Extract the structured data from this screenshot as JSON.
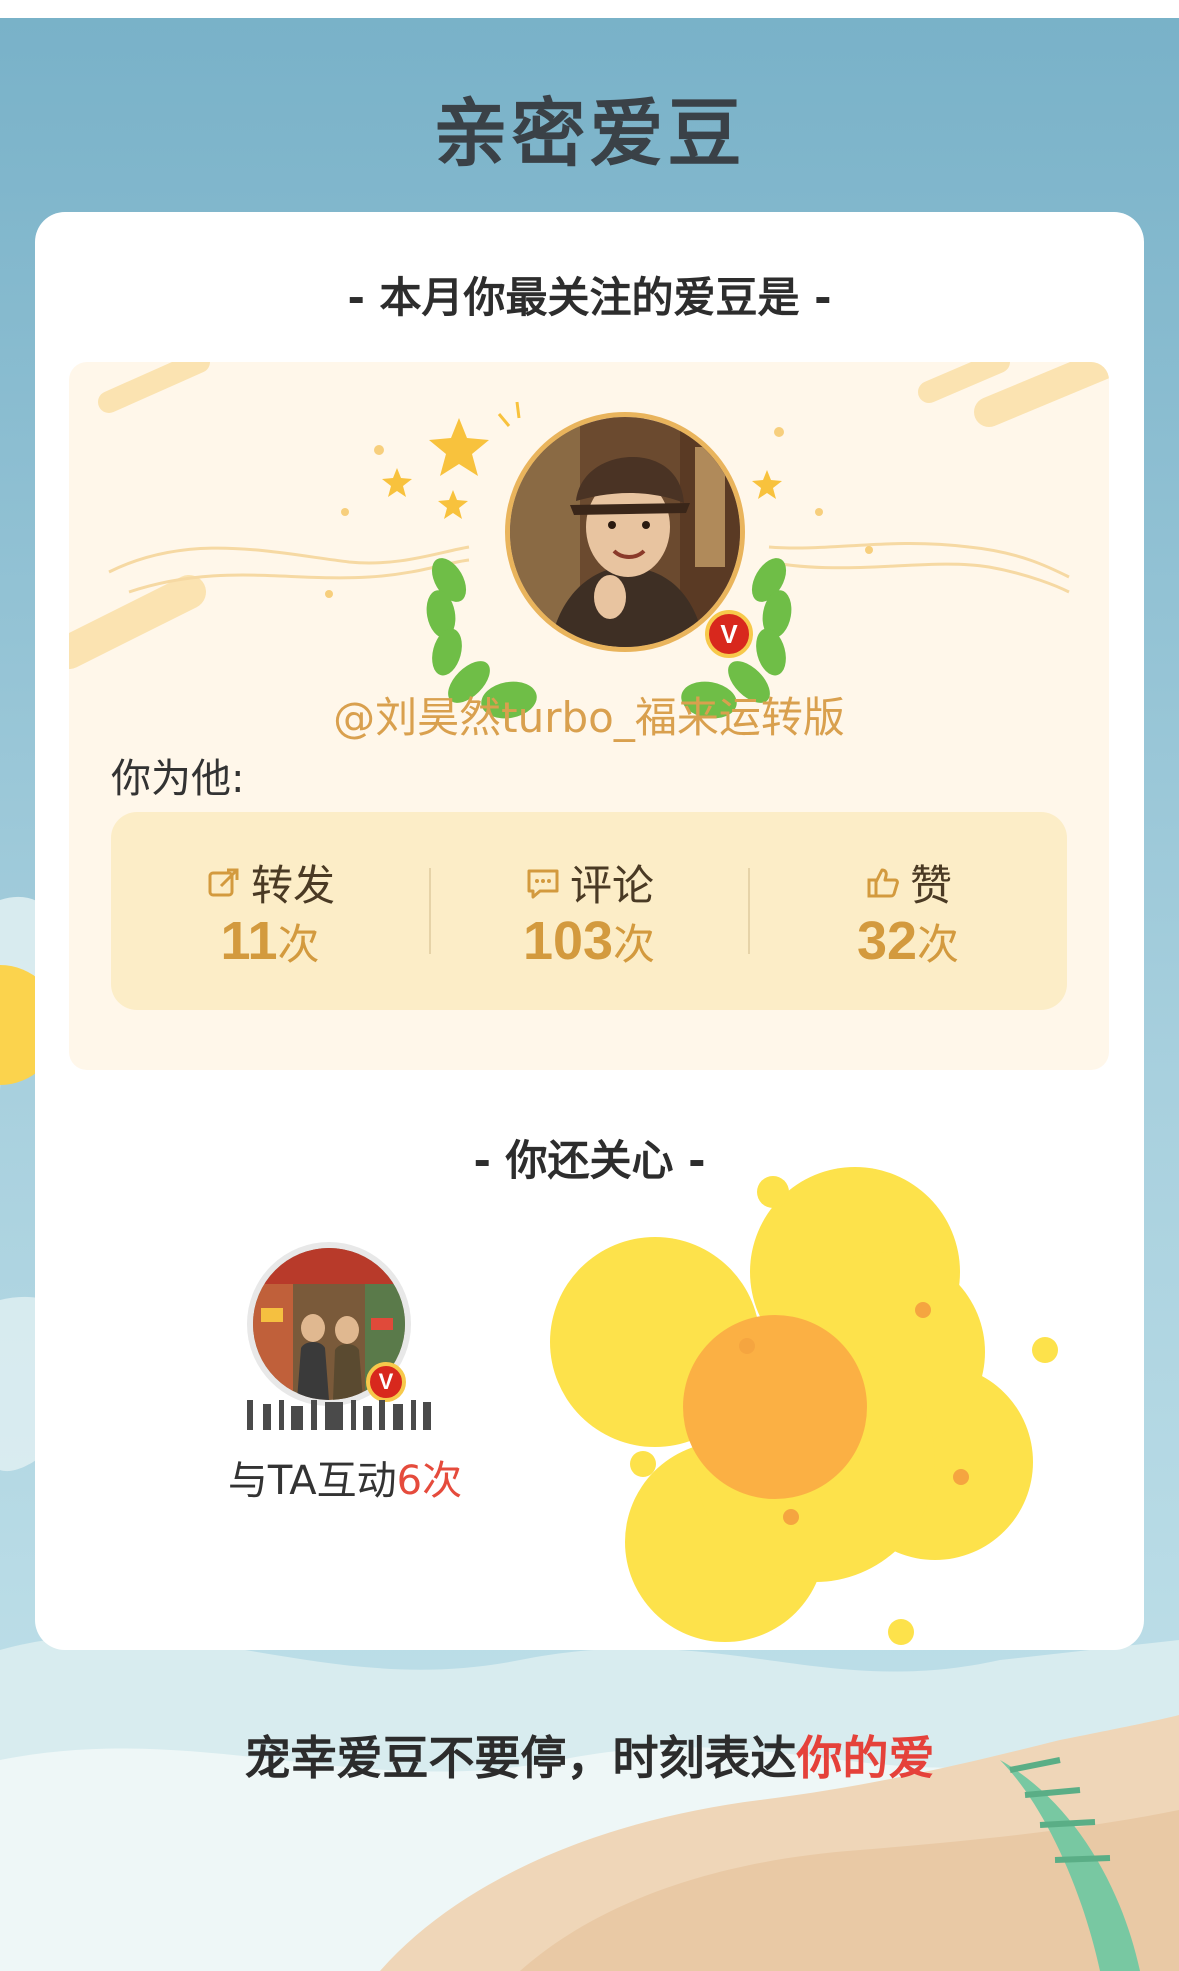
{
  "page": {
    "title": "亲密爱豆"
  },
  "top_idol": {
    "heading": "- 本月你最关注的爱豆是 -",
    "avatar_icon": "user-avatar-photo",
    "verified_badge": "V",
    "name": "@刘昊然turbo_福来运转版",
    "you_for_him_label": "你为他:",
    "stats": [
      {
        "icon": "repost-icon",
        "label": "转发",
        "value": "11",
        "unit": "次"
      },
      {
        "icon": "comment-icon",
        "label": "评论",
        "value": "103",
        "unit": "次"
      },
      {
        "icon": "like-icon",
        "label": "赞",
        "value": "32",
        "unit": "次"
      }
    ]
  },
  "also_care": {
    "heading": "- 你还关心 -",
    "item": {
      "avatar_icon": "poster-avatar",
      "verified_badge": "V",
      "interaction_prefix": "与TA互动",
      "interaction_count": "6次"
    }
  },
  "footer": {
    "text_main": "宠幸爱豆不要停，时刻表达",
    "text_accent": "你的爱"
  },
  "colors": {
    "sky": "#7ab3c9",
    "accent_gold": "#d39a3e",
    "accent_red": "#e5413a",
    "badge_red": "#d8281d",
    "flower_yellow": "#fde24b",
    "flower_center": "#fbb044"
  }
}
